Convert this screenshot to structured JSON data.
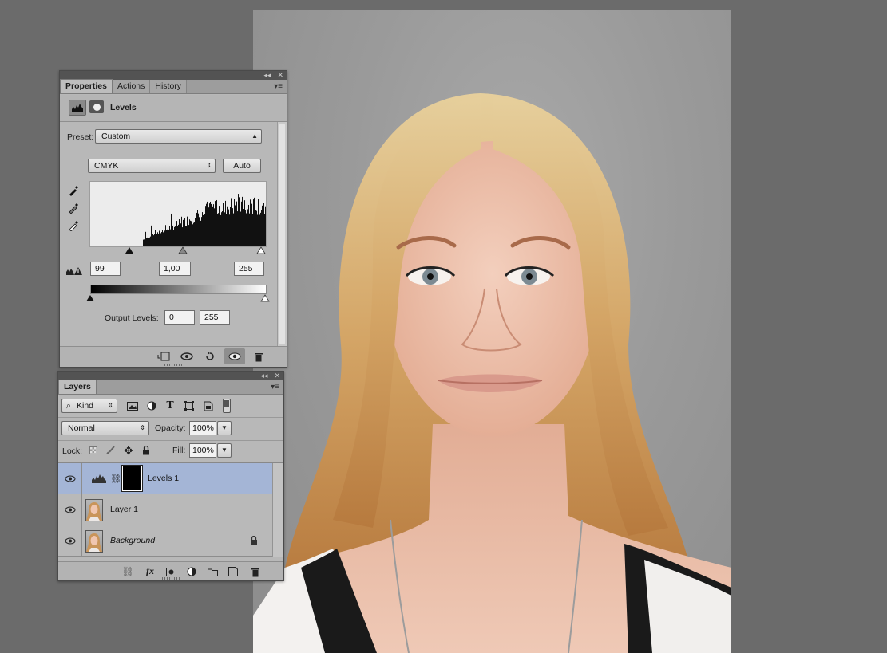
{
  "properties_panel": {
    "tabs": [
      "Properties",
      "Actions",
      "History"
    ],
    "active_tab": "Properties",
    "title": "Levels",
    "preset_label": "Preset:",
    "preset_value": "Custom",
    "channel_value": "CMYK",
    "auto_label": "Auto",
    "input_black": "99",
    "input_gamma": "1,00",
    "input_white": "255",
    "output_label": "Output Levels:",
    "output_black": "0",
    "output_white": "255"
  },
  "layers_panel": {
    "tab": "Layers",
    "filter_value": "Kind",
    "blend_mode": "Normal",
    "opacity_label": "Opacity:",
    "opacity_value": "100%",
    "lock_label": "Lock:",
    "fill_label": "Fill:",
    "fill_value": "100%",
    "layers": [
      {
        "name": "Levels 1",
        "selected": true
      },
      {
        "name": "Layer 1",
        "selected": false
      },
      {
        "name": "Background",
        "selected": false
      }
    ]
  },
  "icons": {
    "close": "close-icon",
    "collapse": "collapse-icon",
    "eyedropper": "eyedropper-icon",
    "eye": "eye-icon",
    "trash": "trash-icon",
    "lock": "lock-icon"
  },
  "colors": {
    "workspace": "#6b6b6b",
    "panel": "#b8b8b8",
    "selected_layer": "#a4b5d6"
  }
}
